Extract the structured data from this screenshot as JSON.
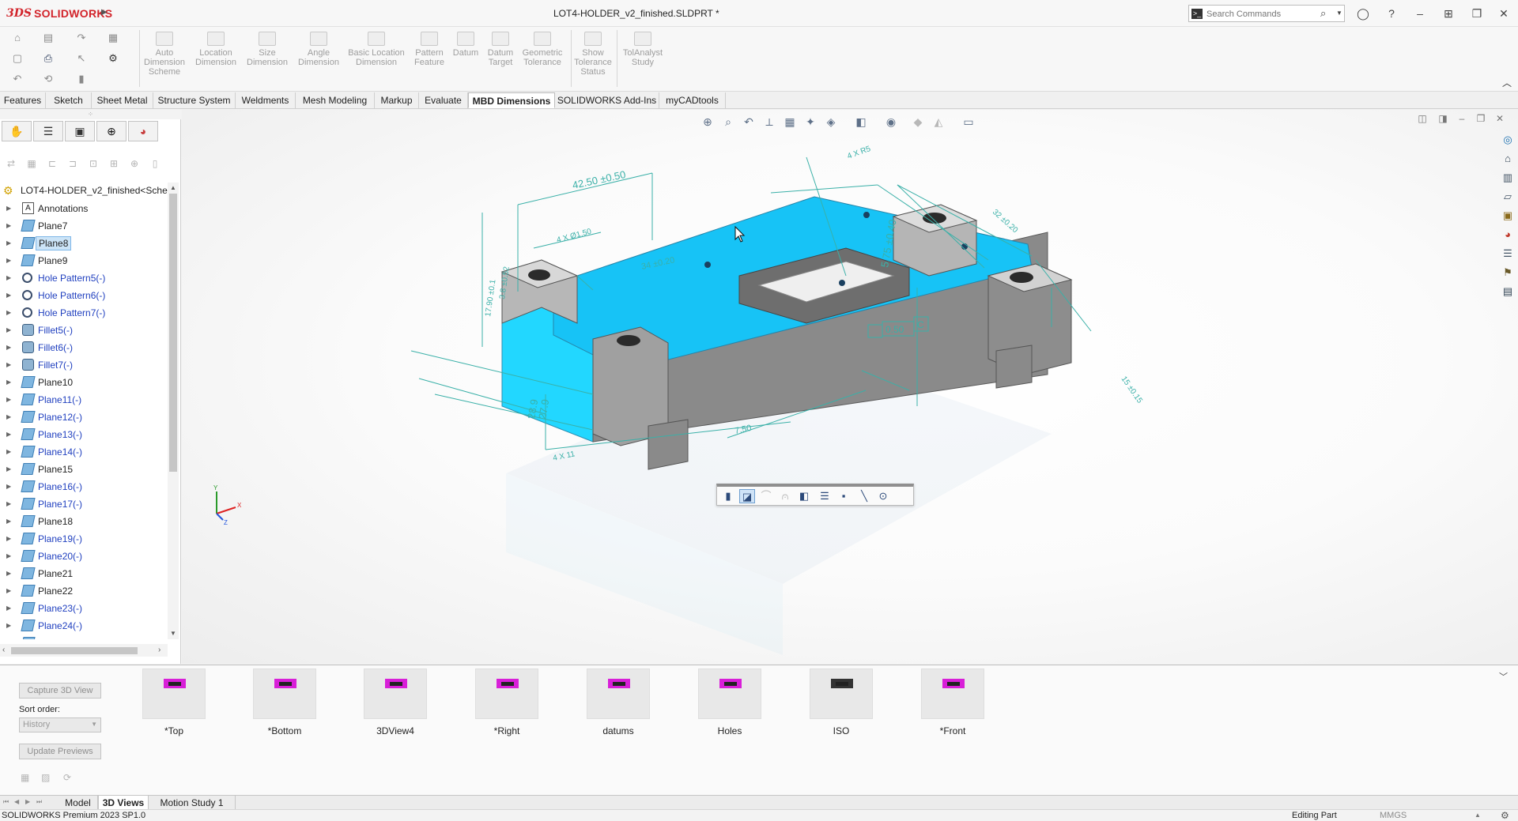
{
  "app": {
    "brand_prefix": "3DS",
    "brand_name": "SOLIDWORKS",
    "document_title": "LOT4-HOLDER_v2_finished.SLDPRT *",
    "search_placeholder": "Search Commands"
  },
  "ribbon": {
    "commands": [
      {
        "label": "Auto\nDimension\nScheme",
        "enabled": false
      },
      {
        "label": "Location\nDimension",
        "enabled": false
      },
      {
        "label": "Size\nDimension",
        "enabled": false
      },
      {
        "label": "Angle\nDimension",
        "enabled": false
      },
      {
        "label": "Basic Location\nDimension",
        "enabled": false
      },
      {
        "label": "Pattern\nFeature",
        "enabled": false
      },
      {
        "label": "Datum",
        "enabled": false
      },
      {
        "label": "Datum\nTarget",
        "enabled": false
      },
      {
        "label": "Geometric\nTolerance",
        "enabled": false
      },
      {
        "label": "Show\nTolerance\nStatus",
        "enabled": false
      },
      {
        "label": "TolAnalyst\nStudy",
        "enabled": false
      }
    ],
    "tabs": [
      "Features",
      "Sketch",
      "Sheet Metal",
      "Structure System",
      "Weldments",
      "Mesh Modeling",
      "Markup",
      "Evaluate",
      "MBD Dimensions",
      "SOLIDWORKS Add-Ins",
      "myCADtools"
    ],
    "active_tab": "MBD Dimensions"
  },
  "tree": {
    "root": "LOT4-HOLDER_v2_finished<Schem",
    "items": [
      {
        "label": "Annotations",
        "icon": "annotations-icon",
        "style": "normal"
      },
      {
        "label": "Plane7",
        "icon": "plane-icon",
        "style": "normal"
      },
      {
        "label": "Plane8",
        "icon": "plane-icon",
        "style": "selected"
      },
      {
        "label": "Plane9",
        "icon": "plane-icon",
        "style": "normal"
      },
      {
        "label": "Hole Pattern5(-)",
        "icon": "hole-pattern-icon",
        "style": "blue"
      },
      {
        "label": "Hole Pattern6(-)",
        "icon": "hole-pattern-icon",
        "style": "blue"
      },
      {
        "label": "Hole Pattern7(-)",
        "icon": "hole-pattern-icon",
        "style": "blue"
      },
      {
        "label": "Fillet5(-)",
        "icon": "fillet-icon",
        "style": "blue"
      },
      {
        "label": "Fillet6(-)",
        "icon": "fillet-icon",
        "style": "blue"
      },
      {
        "label": "Fillet7(-)",
        "icon": "fillet-icon",
        "style": "blue"
      },
      {
        "label": "Plane10",
        "icon": "plane-icon",
        "style": "normal"
      },
      {
        "label": "Plane11(-)",
        "icon": "plane-icon",
        "style": "blue"
      },
      {
        "label": "Plane12(-)",
        "icon": "plane-icon",
        "style": "blue"
      },
      {
        "label": "Plane13(-)",
        "icon": "plane-icon",
        "style": "blue"
      },
      {
        "label": "Plane14(-)",
        "icon": "plane-icon",
        "style": "blue"
      },
      {
        "label": "Plane15",
        "icon": "plane-icon",
        "style": "normal"
      },
      {
        "label": "Plane16(-)",
        "icon": "plane-icon",
        "style": "blue"
      },
      {
        "label": "Plane17(-)",
        "icon": "plane-icon",
        "style": "blue"
      },
      {
        "label": "Plane18",
        "icon": "plane-icon",
        "style": "normal"
      },
      {
        "label": "Plane19(-)",
        "icon": "plane-icon",
        "style": "blue"
      },
      {
        "label": "Plane20(-)",
        "icon": "plane-icon",
        "style": "blue"
      },
      {
        "label": "Plane21",
        "icon": "plane-icon",
        "style": "normal"
      },
      {
        "label": "Plane22",
        "icon": "plane-icon",
        "style": "normal"
      },
      {
        "label": "Plane23(-)",
        "icon": "plane-icon",
        "style": "blue"
      },
      {
        "label": "Plane24(-)",
        "icon": "plane-icon",
        "style": "blue"
      },
      {
        "label": "Plane25(-)",
        "icon": "plane-icon",
        "style": "blue"
      }
    ]
  },
  "viewport": {
    "dimensions": {
      "d1": "42.50 ±0.50",
      "d2": "4 X R5",
      "d3": "5.75 ±0.40",
      "d4": "0.50",
      "d5": "C",
      "d6": "34 ±0.20",
      "d7": "4 X Ø1.50",
      "d8": "28.9",
      "d9": "27.9",
      "d10": "4 X 11",
      "d11": "15 ±0.15",
      "d12": "7.50",
      "d13": "17.90 ±0.1",
      "d14": "3.8 ±0.52",
      "d15": "32 ±0.20"
    },
    "triad_labels": {
      "x": "X",
      "y": "Y",
      "z": "Z"
    },
    "colors": {
      "selected_face": "#1ec8ff",
      "dimension": "#3ab0a8",
      "part": "#8c8c8c"
    }
  },
  "views_panel": {
    "capture_button": "Capture 3D View",
    "sort_label": "Sort order:",
    "sort_value": "History",
    "update_button": "Update Previews",
    "views": [
      "*Top",
      "*Bottom",
      "3DView4",
      "*Right",
      "datums",
      "Holes",
      "ISO",
      "*Front"
    ]
  },
  "bottom_tabs": {
    "tabs": [
      "Model",
      "3D Views",
      "Motion Study 1"
    ],
    "active": "3D Views"
  },
  "status": {
    "product": "SOLIDWORKS Premium 2023 SP1.0",
    "mode": "Editing Part",
    "units": "MMGS"
  }
}
